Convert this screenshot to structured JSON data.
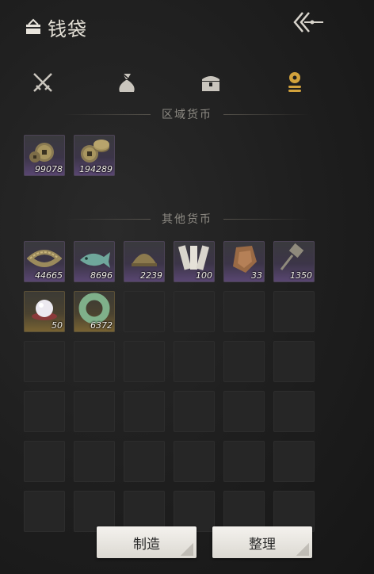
{
  "header": {
    "title": "钱袋",
    "icon": "coin-bag-icon",
    "back_icon": "back-arrow-icon"
  },
  "tabs": [
    {
      "icon": "crossed-swords-icon",
      "active": false
    },
    {
      "icon": "sack-icon",
      "active": false
    },
    {
      "icon": "chest-icon",
      "active": false
    },
    {
      "icon": "currency-icon",
      "active": true
    }
  ],
  "sections": {
    "regional": {
      "title": "区域货币"
    },
    "other": {
      "title": "其他货币"
    }
  },
  "regional_items": [
    {
      "icon": "copper-coins-icon",
      "qty": "99078",
      "rarity": "purple"
    },
    {
      "icon": "copper-coins-stack-icon",
      "qty": "194289",
      "rarity": "purple"
    }
  ],
  "other_items": [
    {
      "icon": "coin-string-icon",
      "qty": "44665",
      "rarity": "purple"
    },
    {
      "icon": "jade-fish-icon",
      "qty": "8696",
      "rarity": "purple"
    },
    {
      "icon": "bronze-shell-coin-icon",
      "qty": "2239",
      "rarity": "purple"
    },
    {
      "icon": "paper-notes-icon",
      "qty": "100",
      "rarity": "purple"
    },
    {
      "icon": "bronze-tablet-icon",
      "qty": "33",
      "rarity": "purple"
    },
    {
      "icon": "spade-coin-icon",
      "qty": "1350",
      "rarity": "purple"
    },
    {
      "icon": "pearl-icon",
      "qty": "50",
      "rarity": "gold"
    },
    {
      "icon": "jade-ring-icon",
      "qty": "6372",
      "rarity": "gold"
    }
  ],
  "empty_slot_count": 28,
  "colors": {
    "accent_gold": "#d2a23c",
    "rarity_purple": "#5a4773",
    "rarity_gold": "#7a6433"
  },
  "buttons": {
    "craft": "制造",
    "sort": "整理"
  }
}
